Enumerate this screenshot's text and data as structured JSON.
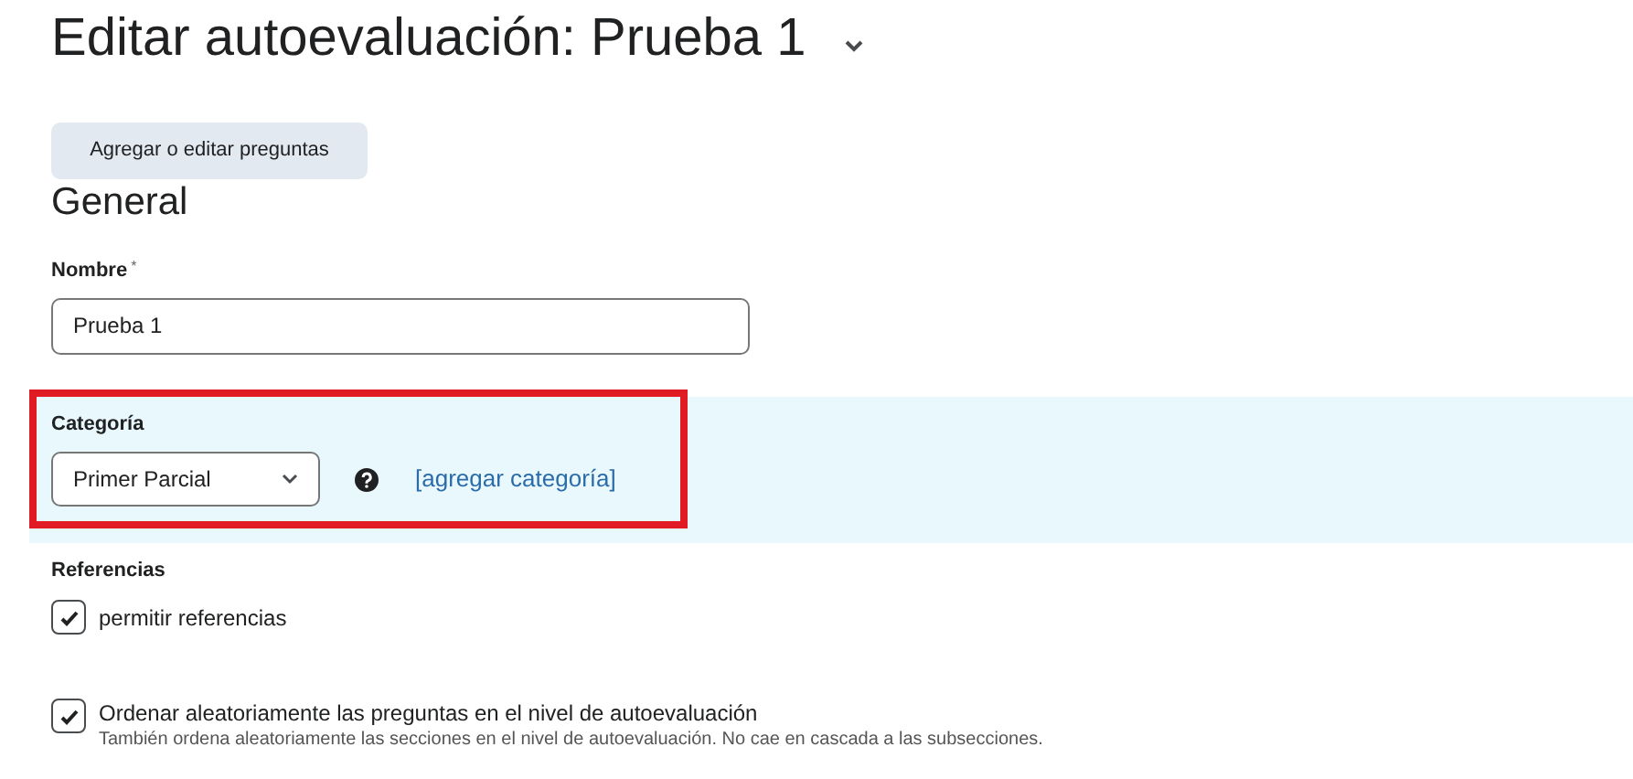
{
  "title": "Editar autoevaluación: Prueba 1",
  "add_questions_button": "Agregar o editar preguntas",
  "section_heading": "General",
  "name_field": {
    "label": "Nombre",
    "required_mark": "*",
    "value": "Prueba 1"
  },
  "category": {
    "label": "Categoría",
    "value": "Primer Parcial",
    "link": "[agregar categoría]",
    "highlighted": true
  },
  "references": {
    "label": "Referencias",
    "checkbox": {
      "label": "permitir referencias",
      "checked": true
    }
  },
  "randomize": {
    "label": "Ordenar aleatoriamente las preguntas en el nivel de autoevaluación",
    "checked": true,
    "description": "También ordena aleatoriamente las secciones en el nivel de autoevaluación. No cae en cascada a las subsecciones."
  }
}
